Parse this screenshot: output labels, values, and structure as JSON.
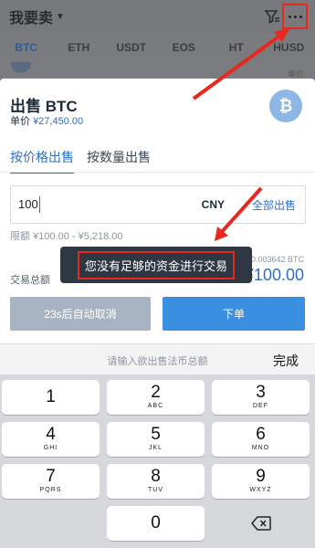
{
  "header": {
    "title": "我要卖"
  },
  "coin_tabs": [
    "BTC",
    "ETH",
    "USDT",
    "EOS",
    "HT",
    "HUSD"
  ],
  "behind_list": {
    "unit_label": "单价"
  },
  "sheet": {
    "title": "出售 BTC",
    "price_label": "单价",
    "price_value": "¥27,450.00",
    "badge_symbol": "₿",
    "modes": [
      "按价格出售",
      "按数量出售"
    ],
    "amount_value": "100",
    "currency": "CNY",
    "sell_all": "全部出售",
    "limit": "限额 ¥100.00 - ¥5,218.00",
    "total_label": "交易总额",
    "total_btc": "0.003642 BTC",
    "total_value": "¥100.00",
    "cancel_button": "23s后自动取消",
    "order_button": "下单"
  },
  "toast": {
    "message": "您没有足够的资金进行交易"
  },
  "keyboard": {
    "hint": "请输入欲出售法币总额",
    "done": "完成",
    "keys": [
      {
        "digit": "1",
        "letters": ""
      },
      {
        "digit": "2",
        "letters": "ABC"
      },
      {
        "digit": "3",
        "letters": "DEF"
      },
      {
        "digit": "4",
        "letters": "GHI"
      },
      {
        "digit": "5",
        "letters": "JKL"
      },
      {
        "digit": "6",
        "letters": "MNO"
      },
      {
        "digit": "7",
        "letters": "PQRS"
      },
      {
        "digit": "8",
        "letters": "TUV"
      },
      {
        "digit": "9",
        "letters": "WXYZ"
      },
      {
        "digit": "0",
        "letters": ""
      }
    ]
  },
  "colors": {
    "accent": "#2e6fc3",
    "annotation": "#e8281f",
    "toast_bg": "#2f3742"
  },
  "icons": {
    "filter": "filter-icon",
    "more": "more-icon",
    "coin": "bitcoin-icon",
    "backspace": "backspace-icon"
  }
}
